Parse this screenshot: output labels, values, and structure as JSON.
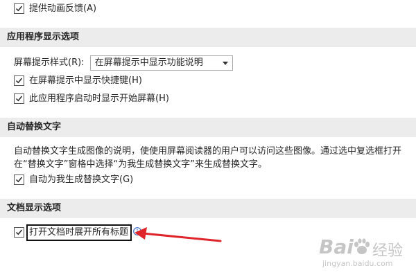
{
  "options": {
    "animation_feedback": "提供动画反馈(A)"
  },
  "app_display": {
    "header": "应用程序显示选项",
    "screentip_label": "屏幕提示样式(R):",
    "screentip_value": "在屏幕提示中显示功能说明",
    "show_shortcut_keys": "在屏幕提示中显示快捷键(H)",
    "show_start_screen": "此应用程序启动时显示开始屏幕(H)"
  },
  "alt_text": {
    "header": "自动替换文字",
    "description_line1": "自动替换文字生成图像的说明，使使用屏幕阅读器的用户可以访问这些图像。通过选中复选框打开",
    "description_line2": "在“替换文字”窗格中选择“为我生成替换文字”来生成替换文字。",
    "auto_generate": "自动为我生成替换文字(G)"
  },
  "doc_display": {
    "header": "文档显示选项",
    "expand_headings": "打开文档时展开所有标题"
  },
  "watermark": {
    "brand_left": "Bai",
    "brand_right": "经验",
    "url": "jingyan.baidu.com"
  },
  "colors": {
    "accent_arrow": "#e0242b",
    "header_bg": "#ececec"
  }
}
